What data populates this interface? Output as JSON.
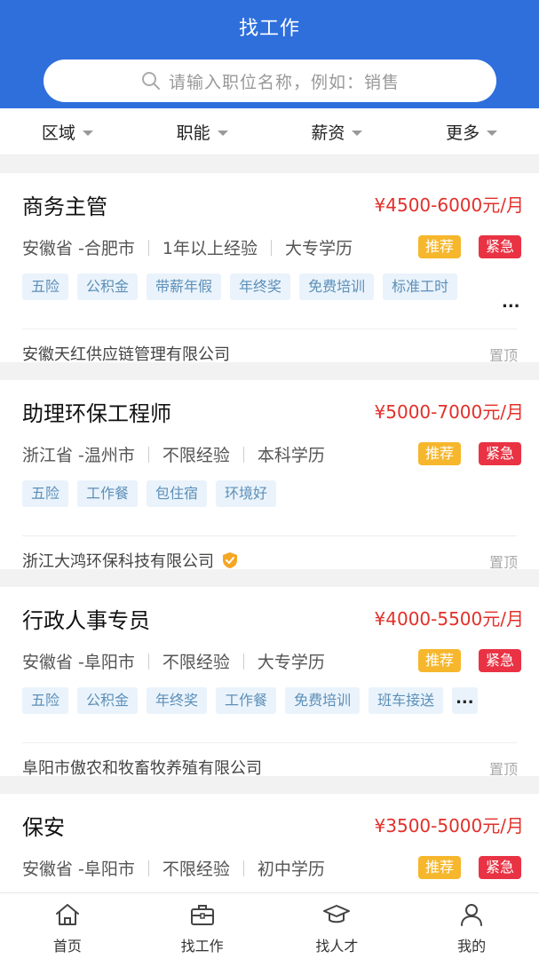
{
  "header": {
    "title": "找工作"
  },
  "search": {
    "placeholder": "请输入职位名称，例如：销售",
    "icon": "search-icon"
  },
  "filters": [
    {
      "label": "区域"
    },
    {
      "label": "职能"
    },
    {
      "label": "薪资"
    },
    {
      "label": "更多"
    }
  ],
  "jobs": [
    {
      "title": "商务主管",
      "salary": "¥4500-6000元/月",
      "location": "安徽省 -合肥市",
      "experience": "1年以上经验",
      "education": "大专学历",
      "badge_recommend": "推荐",
      "badge_urgent": "紧急",
      "tags": [
        "五险",
        "公积金",
        "带薪年假",
        "年终奖",
        "免费培训",
        "标准工时"
      ],
      "tags_more": "...",
      "company": "安徽天红供应链管理有限公司",
      "verified": false,
      "pin": "置顶"
    },
    {
      "title": "助理环保工程师",
      "salary": "¥5000-7000元/月",
      "location": "浙江省 -温州市",
      "experience": "不限经验",
      "education": "本科学历",
      "badge_recommend": "推荐",
      "badge_urgent": "紧急",
      "tags": [
        "五险",
        "工作餐",
        "包住宿",
        "环境好"
      ],
      "tags_more": "",
      "company": "浙江大鸿环保科技有限公司",
      "verified": true,
      "pin": "置顶"
    },
    {
      "title": "行政人事专员",
      "salary": "¥4000-5500元/月",
      "location": "安徽省 -阜阳市",
      "experience": "不限经验",
      "education": "大专学历",
      "badge_recommend": "推荐",
      "badge_urgent": "紧急",
      "tags": [
        "五险",
        "公积金",
        "年终奖",
        "工作餐",
        "免费培训",
        "班车接送"
      ],
      "tags_more": "...",
      "company": "阜阳市傲农和牧畜牧养殖有限公司",
      "verified": false,
      "pin": "置顶"
    },
    {
      "title": "保安",
      "salary": "¥3500-5000元/月",
      "location": "安徽省 -阜阳市",
      "experience": "不限经验",
      "education": "初中学历",
      "badge_recommend": "推荐",
      "badge_urgent": "紧急",
      "tags": [],
      "tags_more": "",
      "company": "",
      "verified": false,
      "pin": ""
    }
  ],
  "tabbar": [
    {
      "label": "首页",
      "icon": "home-icon"
    },
    {
      "label": "找工作",
      "icon": "briefcase-icon"
    },
    {
      "label": "找人才",
      "icon": "graduation-cap-icon"
    },
    {
      "label": "我的",
      "icon": "user-icon"
    }
  ],
  "colors": {
    "primary": "#2e6fdc",
    "salary": "#e2302a",
    "recommend": "#f6b72d",
    "urgent": "#e93344",
    "tag_bg": "#eaf3fb",
    "tag_text": "#5c8fb8"
  }
}
